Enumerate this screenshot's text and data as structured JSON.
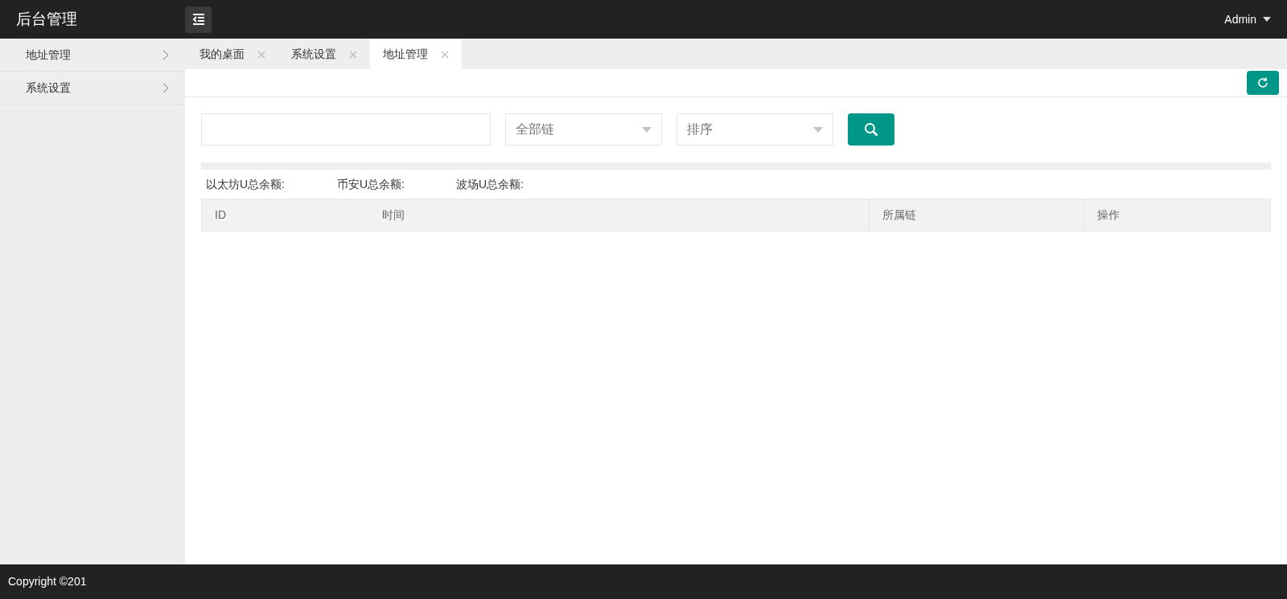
{
  "header": {
    "title": "后台管理",
    "user": "Admin"
  },
  "sidebar": {
    "items": [
      {
        "label": "地址管理",
        "expanded": false
      },
      {
        "label": "系统设置",
        "expanded": false
      }
    ]
  },
  "tabs": [
    {
      "label": "我的桌面",
      "selected": false
    },
    {
      "label": "系统设置",
      "selected": false
    },
    {
      "label": "地址管理",
      "selected": true
    }
  ],
  "filters": {
    "chain_select": {
      "value": "全部链"
    },
    "sort_select": {
      "value": "排序"
    }
  },
  "totals": [
    "以太坊U总余额:",
    "币安U总余额:",
    "波场U总余额:"
  ],
  "table": {
    "columns": [
      "ID",
      "时间",
      "所属链",
      "操作"
    ]
  },
  "footer": {
    "text": "Copyright ©201"
  }
}
